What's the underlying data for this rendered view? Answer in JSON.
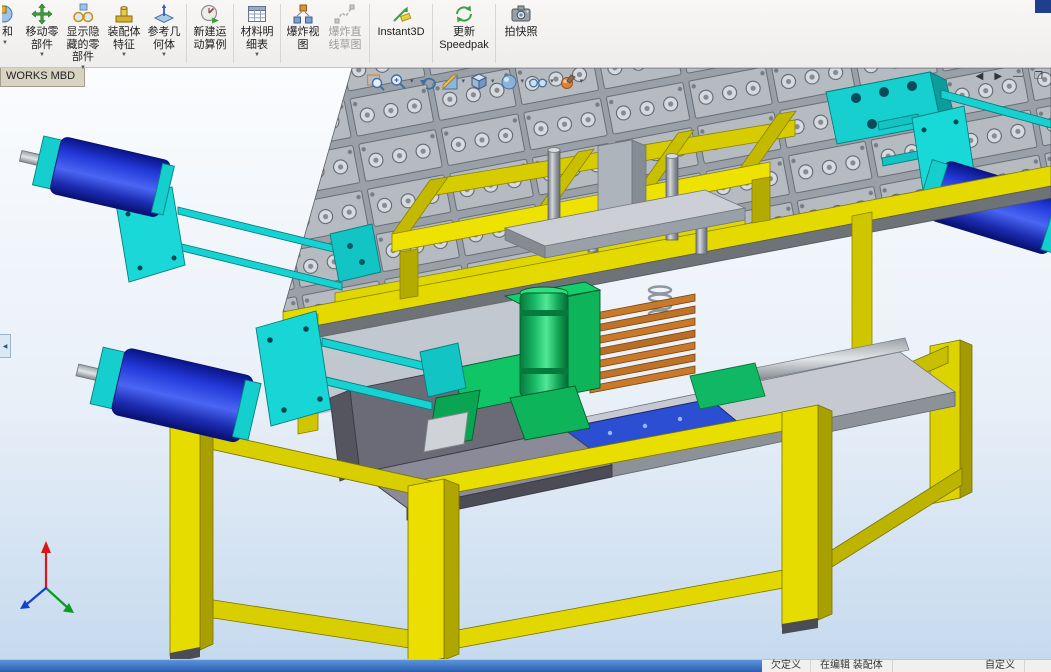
{
  "ribbon": {
    "buttons": [
      {
        "label": "和",
        "caret": "▼"
      },
      {
        "label": "移动零\n部件",
        "caret": "▼"
      },
      {
        "label": "显示隐\n藏的零\n部件",
        "caret": "▼"
      },
      {
        "label": "装配体\n特征",
        "caret": "▼"
      },
      {
        "label": "参考几\n何体",
        "caret": "▼"
      },
      {
        "label": "新建运\n动算例"
      },
      {
        "label": "材料明\n细表",
        "caret": "▼"
      },
      {
        "label": "爆炸视\n图"
      },
      {
        "label": "爆炸直\n线草图"
      },
      {
        "label": "Instant3D"
      },
      {
        "label": "更新\nSpeedpak"
      },
      {
        "label": "拍快照"
      }
    ]
  },
  "document_tab": {
    "label": "WORKS MBD"
  },
  "view_toolbar": {
    "caret": "▾",
    "icons": [
      "zoom-fit-icon",
      "zoom-to-area-icon",
      "previous-view-icon",
      "section-view-icon",
      "view-orientation-icon",
      "display-style-icon",
      "hide-show-items-icon",
      "edit-appearance-icon"
    ]
  },
  "window_controls": {
    "scroll_left": "◀",
    "scroll_right": "▶",
    "minimize": "—",
    "restore": "❐"
  },
  "panel_handle": {
    "glyph": "◀"
  },
  "status_bar": {
    "state": "欠定义",
    "mode": "在编辑 装配体",
    "custom": "自定义"
  },
  "model": {
    "description": "Isometric CAD assembly: yellow welded frame table, pallet conveyor deck, four blue pneumatic cylinders on cyan mounting plates, central green gripper mechanism with orange plate stack on blue base plate",
    "colors": {
      "frame_yellow": "#e6dc00",
      "cylinder_blue": "#2238d8",
      "mount_cyan": "#19d6d6",
      "mechanism_green": "#18b864",
      "stack_orange": "#c8792a",
      "plate_gray": "#c6cad0",
      "background_bottom": "#c6daee"
    }
  }
}
